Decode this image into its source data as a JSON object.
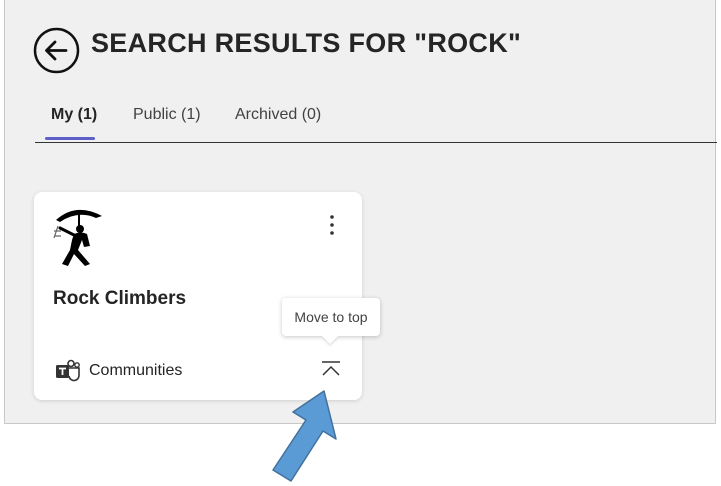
{
  "header": {
    "title": "SEARCH RESULTS FOR \"ROCK\"",
    "back_icon": "arrow-left-circle-icon"
  },
  "tabs": [
    {
      "label": "My (1)",
      "active": true
    },
    {
      "label": "Public (1)",
      "active": false
    },
    {
      "label": "Archived (0)",
      "active": false
    }
  ],
  "results": [
    {
      "name": "Rock Climbers",
      "app": "Communities",
      "app_icon": "teams-icon",
      "avatar_icon": "climber-umbrella-icon",
      "more_icon": "more-vertical-icon",
      "pin_icon": "move-to-top-icon"
    }
  ],
  "tooltip": {
    "text": "Move to top"
  },
  "colors": {
    "accent": "#5b5fc7",
    "panel_bg": "#f0f0f0",
    "card_bg": "#ffffff",
    "arrow_fill": "#5b9bd5",
    "arrow_stroke": "#41719c"
  }
}
